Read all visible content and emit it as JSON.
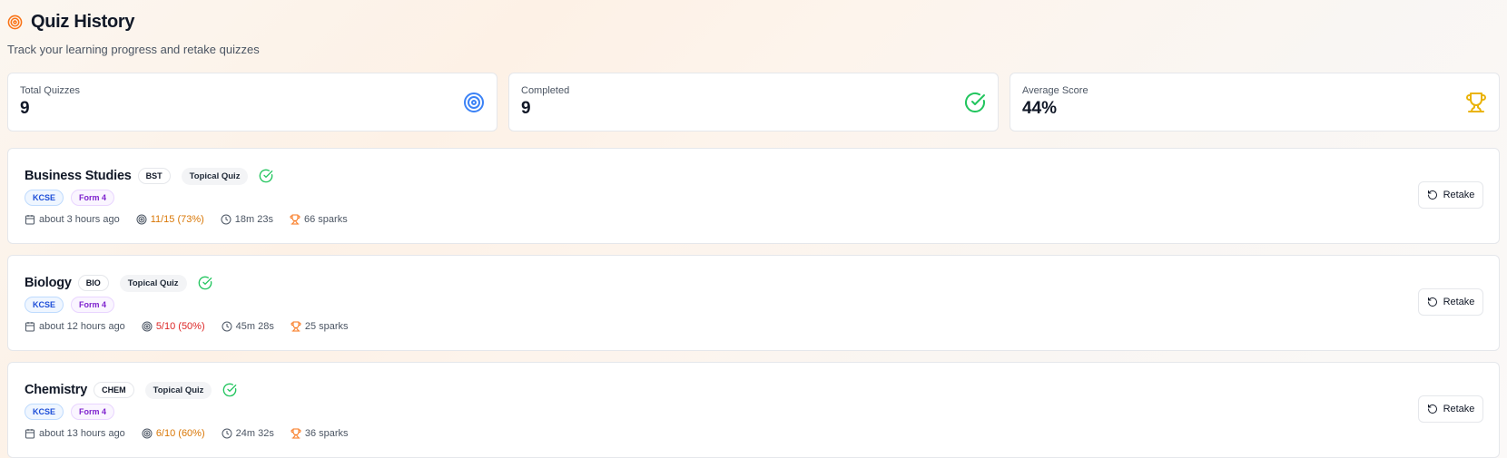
{
  "page": {
    "title": "Quiz History",
    "subtitle": "Track your learning progress and retake quizzes",
    "title_icon": "target-icon"
  },
  "stats": [
    {
      "label": "Total Quizzes",
      "value": "9",
      "icon": "target-icon",
      "color": "#3b82f6"
    },
    {
      "label": "Completed",
      "value": "9",
      "icon": "check-circle-icon",
      "color": "#22c55e"
    },
    {
      "label": "Average Score",
      "value": "44%",
      "icon": "trophy-icon",
      "color": "#eab308"
    }
  ],
  "quizzes": [
    {
      "subject": "Business Studies",
      "code": "BST",
      "type": "Topical Quiz",
      "exam": "KCSE",
      "level": "Form 4",
      "time_ago": "about 3 hours ago",
      "score": "11/15 (73%)",
      "score_color": "#d97706",
      "duration": "18m 23s",
      "sparks": "66 sparks",
      "action": "Retake"
    },
    {
      "subject": "Biology",
      "code": "BIO",
      "type": "Topical Quiz",
      "exam": "KCSE",
      "level": "Form 4",
      "time_ago": "about 12 hours ago",
      "score": "5/10 (50%)",
      "score_color": "#dc2626",
      "duration": "45m 28s",
      "sparks": "25 sparks",
      "action": "Retake"
    },
    {
      "subject": "Chemistry",
      "code": "CHEM",
      "type": "Topical Quiz",
      "exam": "KCSE",
      "level": "Form 4",
      "time_ago": "about 13 hours ago",
      "score": "6/10 (60%)",
      "score_color": "#d97706",
      "duration": "24m 32s",
      "sparks": "36 sparks",
      "action": "Retake"
    }
  ],
  "colors": {
    "accent_orange": "#f97316",
    "success_green": "#22c55e",
    "target_blue": "#3b82f6",
    "trophy_yellow": "#eab308"
  }
}
